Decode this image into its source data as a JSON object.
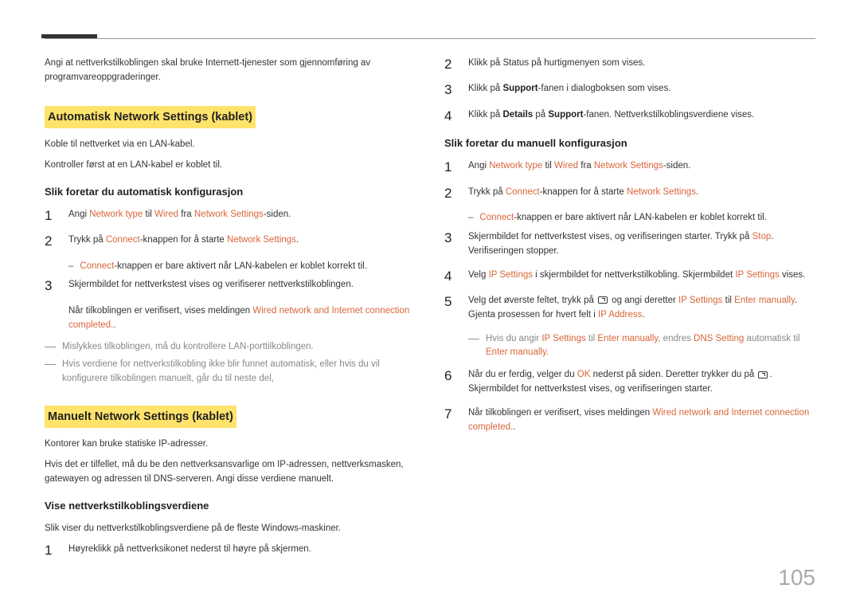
{
  "pageNumber": "105",
  "left": {
    "intro": "Angi at nettverkstilkoblingen skal bruke Internett-tjenester som gjennomføring av programvareoppgraderinger.",
    "h1": "Automatisk Network Settings  (kablet)",
    "p1": "Koble til nettverket via en LAN-kabel.",
    "p2": "Kontroller først at en LAN-kabel er koblet til.",
    "sub1": "Slik foretar du automatisk konfigurasjon",
    "s1": {
      "n": "1",
      "pre": "Angi ",
      "a": "Network type",
      "mid1": " til ",
      "b": "Wired",
      "mid2": " fra ",
      "c": "Network Settings",
      "post": "-siden."
    },
    "s2": {
      "n": "2",
      "pre": "Trykk på ",
      "a": "Connect",
      "mid": "-knappen for å starte ",
      "b": "Network Settings",
      "post": ".",
      "dashPre": "",
      "dashA": "Connect",
      "dashPost": "-knappen er bare aktivert når LAN-kabelen er koblet korrekt til."
    },
    "s3": {
      "n": "3",
      "body": "Skjermbildet for nettverkstest vises og verifiserer nettverkstilkoblingen.",
      "dashPre": "Når tilkoblingen er verifisert, vises meldingen ",
      "dashA": "Wired network and Internet connection completed.",
      "dashPost": "."
    },
    "outer1": "Mislykkes tilkoblingen, må du kontrollere LAN-porttilkoblingen.",
    "outer2": "Hvis verdiene for nettverkstilkobling ikke blir funnet automatisk, eller hvis du vil konfigurere tilkoblingen manuelt, går du til neste del,",
    "h2": "Manuelt Network Settings (kablet)",
    "p3": "Kontorer kan bruke statiske IP-adresser.",
    "p4": "Hvis det er tilfellet, må du be den nettverksansvarlige om IP-adressen, nettverksmasken, gatewayen og adressen til DNS-serveren. Angi disse verdiene manuelt.",
    "sub2": "Vise nettverkstilkoblingsverdiene",
    "p5": "Slik viser du nettverkstilkoblingsverdiene på de fleste Windows-maskiner.",
    "s4": {
      "n": "1",
      "body": "Høyreklikk på nettverksikonet nederst til høyre på skjermen."
    }
  },
  "right": {
    "s2": {
      "n": "2",
      "body": "Klikk på Status på hurtigmenyen som vises."
    },
    "s3": {
      "n": "3",
      "pre": "Klikk på ",
      "a": "Support",
      "post": "-fanen i dialogboksen som vises."
    },
    "s4": {
      "n": "4",
      "pre": "Klikk på ",
      "a": "Details",
      "mid": " på ",
      "b": "Support",
      "post": "-fanen. Nettverkstilkoblingsverdiene vises."
    },
    "sub1": "Slik foretar du manuell konfigurasjon",
    "m1": {
      "n": "1",
      "pre": "Angi ",
      "a": "Network type",
      "mid1": " til ",
      "b": "Wired",
      "mid2": " fra ",
      "c": "Network Settings",
      "post": "-siden."
    },
    "m2": {
      "n": "2",
      "pre": "Trykk på ",
      "a": "Connect",
      "mid": "-knappen for å starte ",
      "b": "Network Settings",
      "post": ".",
      "dashA": "Connect",
      "dashPost": "-knappen er bare aktivert når LAN-kabelen er koblet korrekt til."
    },
    "m3": {
      "n": "3",
      "pre": "Skjermbildet for nettverkstest vises, og verifiseringen starter. Trykk på ",
      "a": "Stop",
      "post": ". Verifiseringen stopper."
    },
    "m4": {
      "n": "4",
      "pre": "Velg ",
      "a": "IP Settings",
      "mid": " i skjermbildet for nettverkstilkobling. Skjermbildet ",
      "b": "IP Settings",
      "post": " vises."
    },
    "m5": {
      "n": "5",
      "pre": "Velg det øverste feltet, trykk på ",
      "mid1": " og angi deretter ",
      "a": "IP Settings",
      "mid2": " til ",
      "b": "Enter manually",
      "mid3": ". Gjenta prosessen for hvert felt i ",
      "c": "IP Address",
      "post": ".",
      "dashPre": "Hvis du angir ",
      "dA": "IP Settings",
      "dMid1": " til ",
      "dB": "Enter manually",
      "dMid2": ", endres ",
      "dC": "DNS Setting",
      "dMid3": " automatisk til ",
      "dD": "Enter manually",
      "dPost": "."
    },
    "m6": {
      "n": "6",
      "pre": "Når du er ferdig, velger du ",
      "a": "OK",
      "mid": " nederst på siden. Deretter trykker du på ",
      "post": ". Skjermbildet for nettverkstest vises, og verifiseringen starter."
    },
    "m7": {
      "n": "7",
      "pre": "Når tilkoblingen er verifisert, vises meldingen ",
      "a": "Wired network and Internet connection completed.",
      "post": "."
    }
  }
}
